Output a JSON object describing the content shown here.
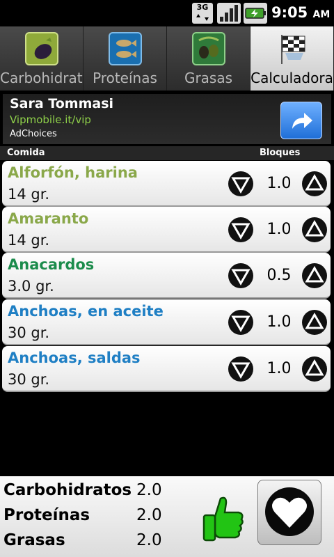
{
  "status_bar": {
    "network": "3G",
    "time": "9:05",
    "ampm": "AM"
  },
  "tabs": [
    {
      "label": "Carbohidratos",
      "icon": "eggplant-icon",
      "active": false
    },
    {
      "label": "Proteínas",
      "icon": "fish-icon",
      "active": false
    },
    {
      "label": "Grasas",
      "icon": "olives-icon",
      "active": false
    },
    {
      "label": "Calculadora",
      "icon": "checkered-flag-icon",
      "active": true
    }
  ],
  "ad": {
    "title": "Sara Tommasi",
    "url": "Vipmobile.it/vip",
    "choices": "AdChoices",
    "button_icon": "share-arrow-icon"
  },
  "list_header": {
    "food": "Comida",
    "blocks": "Bloques"
  },
  "foods": [
    {
      "name": "Alforfón, harina",
      "portion": "14 gr.",
      "blocks": "1.0",
      "color": "#8aa84a"
    },
    {
      "name": "Amaranto",
      "portion": "14 gr.",
      "blocks": "1.0",
      "color": "#8aa84a"
    },
    {
      "name": "Anacardos",
      "portion": "3.0 gr.",
      "blocks": "0.5",
      "color": "#1c8c4c"
    },
    {
      "name": "Anchoas, en aceite",
      "portion": "30 gr.",
      "blocks": "1.0",
      "color": "#1f7fc4"
    },
    {
      "name": "Anchoas, saldas",
      "portion": "30 gr.",
      "blocks": "1.0",
      "color": "#1f7fc4"
    }
  ],
  "totals": {
    "carbs_label": "Carbohidratos",
    "carbs_value": "2.0",
    "protein_label": "Proteínas",
    "protein_value": "2.0",
    "fat_label": "Grasas",
    "fat_value": "2.0"
  },
  "colors": {
    "ok_green": "#22c414",
    "ad_url": "#8fd14a",
    "ad_button": "#3a8cf0"
  }
}
